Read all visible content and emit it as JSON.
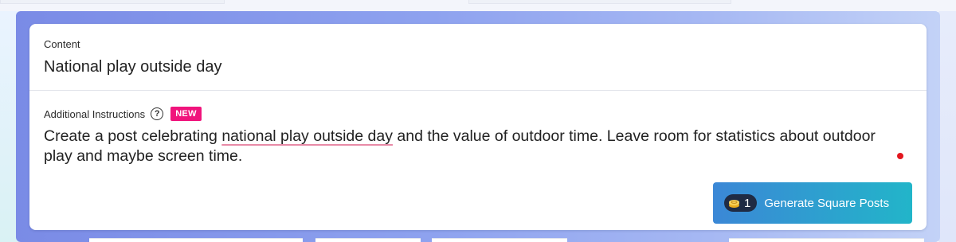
{
  "content": {
    "label": "Content",
    "value": "National play outside day"
  },
  "additional_instructions": {
    "label": "Additional Instructions",
    "help_icon": "question-circle-icon",
    "badge": "NEW",
    "text_before": "Create a post celebrating ",
    "text_underlined": "national play outside day",
    "text_after": " and the value of outdoor time. Leave room for statistics about outdoor play and maybe screen time."
  },
  "generate_button": {
    "credit_icon": "coin-stack-icon",
    "credits": "1",
    "label": "Generate Square Posts"
  },
  "colors": {
    "badge_bg": "#f0147c",
    "button_gradient_start": "#3b87d6",
    "button_gradient_end": "#22b5c9",
    "frame_gradient_start": "#7a8be6",
    "frame_gradient_end": "#c3d2f7",
    "unsaved_dot": "#e3171f",
    "spellcheck_underline": "#e88aa7"
  }
}
